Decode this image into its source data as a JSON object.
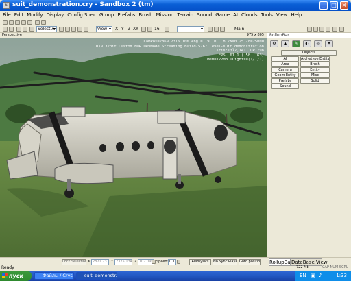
{
  "window": {
    "title": "suit_demonstration.cry - Sandbox 2 (tm)",
    "app_icon": "sandbox-icon"
  },
  "menu": [
    "File",
    "Edit",
    "Modify",
    "Display",
    "Config Spec",
    "Group",
    "Prefabs",
    "Brush",
    "Mission",
    "Terrain",
    "Sound",
    "Game",
    "AI",
    "Clouds",
    "Tools",
    "View",
    "Help"
  ],
  "toolbar": {
    "select_mode": "Select A",
    "view_mode": "View",
    "axes": [
      "X",
      "Y",
      "Z",
      "XY"
    ],
    "grid": "16",
    "layer_name": "Main"
  },
  "viewport": {
    "title": "Perspective",
    "resolution": "975 x 805",
    "info_lines": [
      "CamPos=2869 2316 106 Angl=  9  0   8 ZN=0.25 ZF=25000",
      "DX9 32bit Custom HDR DevMode Streaming Build-5767 Level-suit_demonstration",
      "Tris:1377,141  DP:798",
      "FPS  61.1 ( 58.. 63)",
      "Mem=722MB DLights=(1/1/1)"
    ]
  },
  "rollup": {
    "title": "RollupBar",
    "section_header": "Objects",
    "buttons": [
      "AI",
      "Archetype Entity",
      "Area",
      "Brush",
      "Camera",
      "Entity",
      "Geom Entity",
      "Misc",
      "Prefabs",
      "Solid",
      "Sound"
    ]
  },
  "status": {
    "lock_selection": "Lock Selection",
    "x_label": "X",
    "x_value": "2871.23",
    "y_label": "Y",
    "y_value": "2325.134",
    "z_label": "Z",
    "z_value": "102.099",
    "speed_label": "Speed:",
    "speed_value": "0.1",
    "ai_physics": "AI/Physics",
    "no_sync": "No Sync Player",
    "goto": "Goto position",
    "tab_rollup": "RollupBar",
    "tab_database": "DataBase View",
    "ready": "Ready",
    "memory": "722 Mb",
    "indicators": "CAP  NUM  SCRL"
  },
  "taskbar": {
    "start": "пуск",
    "tasks": [
      "Файлы / Crysi...",
      "suit_demonstr..."
    ],
    "clock": "1:33"
  }
}
